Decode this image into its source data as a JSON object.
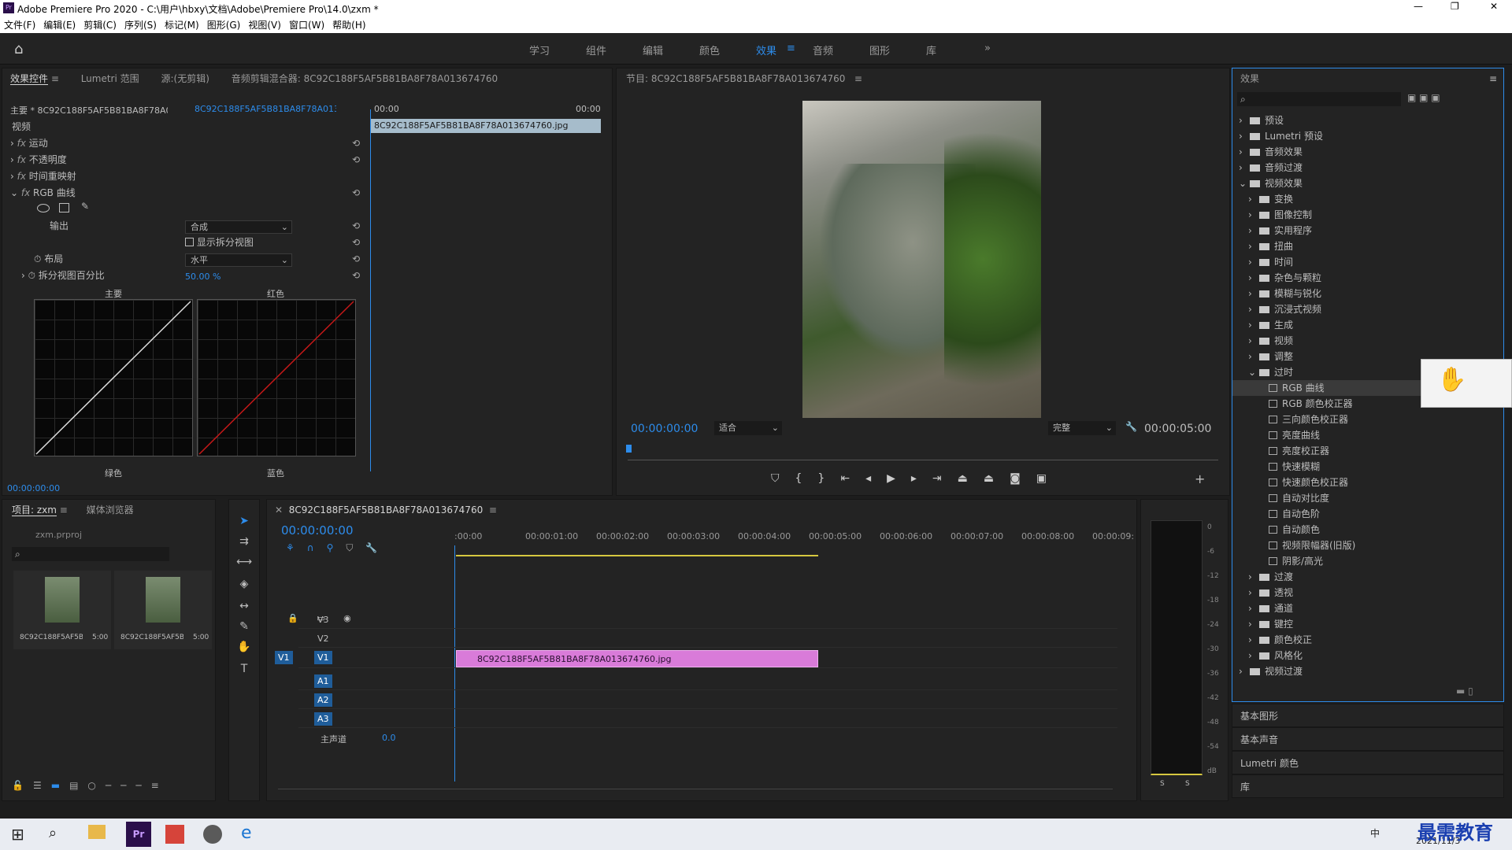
{
  "title": "Adobe Premiere Pro 2020 - C:\\用户\\hbxy\\文档\\Adobe\\Premiere Pro\\14.0\\zxm *",
  "menu": [
    "文件(F)",
    "编辑(E)",
    "剪辑(C)",
    "序列(S)",
    "标记(M)",
    "图形(G)",
    "视图(V)",
    "窗口(W)",
    "帮助(H)"
  ],
  "workspaces": [
    "学习",
    "组件",
    "编辑",
    "颜色",
    "效果",
    "音频",
    "图形",
    "库"
  ],
  "ec": {
    "tabs": [
      "效果控件",
      "Lumetri 范围",
      "源:(无剪辑)",
      "音频剪辑混合器: 8C92C188F5AF5B81BA8F78A013674760"
    ],
    "master": "主要 * 8C92C188F5AF5B81BA8F78A01...",
    "seq": "8C92C188F5AF5B81BA8F78A013674760...",
    "time0": "00:00",
    "time1": "00:00",
    "clip": "8C92C188F5AF5B81BA8F78A013674760.jpg",
    "video": "视频",
    "motion": "运动",
    "opacity": "不透明度",
    "remap": "时间重映射",
    "curves": "RGB 曲线",
    "output": "输出",
    "output_val": "合成",
    "split": "显示拆分视图",
    "layout": "布局",
    "layout_val": "水平",
    "pct": "拆分视图百分比",
    "pct_val": "50.00 %",
    "g1": "主要",
    "g2": "红色",
    "g3": "绿色",
    "g4": "蓝色",
    "tc": "00:00:00:00"
  },
  "program": {
    "title": "节目: 8C92C188F5AF5B81BA8F78A013674760",
    "tc": "00:00:00:00",
    "fit": "适合",
    "quality": "完整",
    "dur": "00:00:05:00"
  },
  "effects": {
    "title": "效果",
    "items": [
      {
        "l": "预设",
        "d": 0,
        "t": "f"
      },
      {
        "l": "Lumetri 预设",
        "d": 0,
        "t": "f"
      },
      {
        "l": "音频效果",
        "d": 0,
        "t": "f"
      },
      {
        "l": "音频过渡",
        "d": 0,
        "t": "f"
      },
      {
        "l": "视频效果",
        "d": 0,
        "t": "f"
      },
      {
        "l": "变换",
        "d": 1,
        "t": "f"
      },
      {
        "l": "图像控制",
        "d": 1,
        "t": "f"
      },
      {
        "l": "实用程序",
        "d": 1,
        "t": "f"
      },
      {
        "l": "扭曲",
        "d": 1,
        "t": "f"
      },
      {
        "l": "时间",
        "d": 1,
        "t": "f"
      },
      {
        "l": "杂色与颗粒",
        "d": 1,
        "t": "f"
      },
      {
        "l": "模糊与锐化",
        "d": 1,
        "t": "f"
      },
      {
        "l": "沉浸式视频",
        "d": 1,
        "t": "f"
      },
      {
        "l": "生成",
        "d": 1,
        "t": "f"
      },
      {
        "l": "视频",
        "d": 1,
        "t": "f"
      },
      {
        "l": "调整",
        "d": 1,
        "t": "f"
      },
      {
        "l": "过时",
        "d": 1,
        "t": "f"
      },
      {
        "l": "RGB 曲线",
        "d": 2,
        "t": "e"
      },
      {
        "l": "RGB 颜色校正器",
        "d": 2,
        "t": "e"
      },
      {
        "l": "三向颜色校正器",
        "d": 2,
        "t": "e"
      },
      {
        "l": "亮度曲线",
        "d": 2,
        "t": "e"
      },
      {
        "l": "亮度校正器",
        "d": 2,
        "t": "e"
      },
      {
        "l": "快速模糊",
        "d": 2,
        "t": "e"
      },
      {
        "l": "快速颜色校正器",
        "d": 2,
        "t": "e"
      },
      {
        "l": "自动对比度",
        "d": 2,
        "t": "e"
      },
      {
        "l": "自动色阶",
        "d": 2,
        "t": "e"
      },
      {
        "l": "自动颜色",
        "d": 2,
        "t": "e"
      },
      {
        "l": "视频限幅器(旧版)",
        "d": 2,
        "t": "e"
      },
      {
        "l": "阴影/高光",
        "d": 2,
        "t": "e"
      },
      {
        "l": "过渡",
        "d": 1,
        "t": "f"
      },
      {
        "l": "透视",
        "d": 1,
        "t": "f"
      },
      {
        "l": "通道",
        "d": 1,
        "t": "f"
      },
      {
        "l": "键控",
        "d": 1,
        "t": "f"
      },
      {
        "l": "颜色校正",
        "d": 1,
        "t": "f"
      },
      {
        "l": "风格化",
        "d": 1,
        "t": "f"
      },
      {
        "l": "视频过渡",
        "d": 0,
        "t": "f"
      }
    ],
    "sections": [
      "基本图形",
      "基本声音",
      "Lumetri 颜色",
      "库"
    ]
  },
  "project": {
    "tabs": [
      "项目: zxm",
      "媒体浏览器"
    ],
    "file": "zxm.prproj",
    "items": [
      {
        "name": "8C92C188F5AF5B...",
        "dur": "5:00"
      },
      {
        "name": "8C92C188F5AF5B...",
        "dur": "5:00"
      }
    ]
  },
  "timeline": {
    "tab": "8C92C188F5AF5B81BA8F78A013674760",
    "tc": "00:00:00:00",
    "ruler": [
      ":00:00",
      "00:00:01:00",
      "00:00:02:00",
      "00:00:03:00",
      "00:00:04:00",
      "00:00:05:00",
      "00:00:06:00",
      "00:00:07:00",
      "00:00:08:00",
      "00:00:09:"
    ],
    "vtracks": [
      "V3",
      "V2",
      "V1"
    ],
    "atracks": [
      "A1",
      "A2",
      "A3"
    ],
    "master": "主声道",
    "master_val": "0.0",
    "clip": "8C92C188F5AF5B81BA8F78A013674760.jpg",
    "src": "V1"
  },
  "meter": {
    "scale": [
      "0",
      "-6",
      "-12",
      "-18",
      "-24",
      "-30",
      "-36",
      "-42",
      "-48",
      "-54",
      "dB"
    ],
    "solo": [
      "S",
      "S"
    ]
  },
  "taskbar": {
    "date": "2021/11/3",
    "ime": "中"
  },
  "watermark": "最需教育"
}
